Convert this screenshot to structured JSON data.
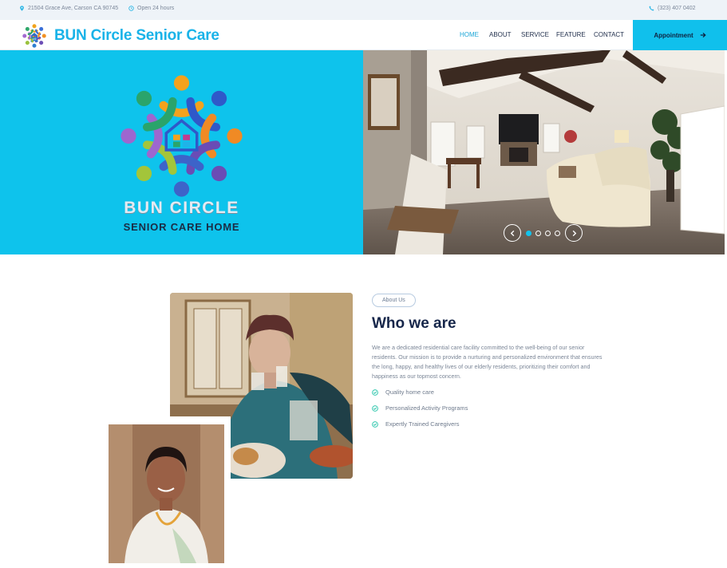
{
  "topbar": {
    "address": "21504 Grace Ave, Carson CA 90745",
    "hours": "Open 24 hours",
    "phone": "(323) 407 0402",
    "icons": [
      "map-pin-icon",
      "clock-icon",
      "phone-icon"
    ]
  },
  "header": {
    "brand_name": "BUN Circle Senior Care",
    "nav": [
      {
        "label": "HOME",
        "active": true
      },
      {
        "label": "ABOUT",
        "active": false
      },
      {
        "label": "SERVICE",
        "active": false
      },
      {
        "label": "FEATURE",
        "active": false
      },
      {
        "label": "CONTACT",
        "active": false
      }
    ],
    "appointment_label": "Appointment"
  },
  "hero": {
    "logo_title": "BUN CIRCLE",
    "logo_subtitle": "SENIOR CARE HOME",
    "carousel_active_index": 0,
    "carousel_slide_count": 4
  },
  "about": {
    "badge": "About Us",
    "heading": "Who we are",
    "description": "We are a dedicated residential care facility committed to the well-being of our senior residents. Our mission is to provide a nurturing and personalized environment that ensures the long, happy, and healthy lives of our elderly residents, prioritizing their comfort and happiness as our topmost concern.",
    "features": [
      "Quality home care",
      "Personalized Activity Programs",
      "Expertly Trained Caregivers"
    ]
  },
  "colors": {
    "brand": "#1ab3e8",
    "hero_bg": "#0ec3ec",
    "appointment_bg": "#10c0ec",
    "heading": "#16264a",
    "topbar_bg": "#eef3f8"
  }
}
